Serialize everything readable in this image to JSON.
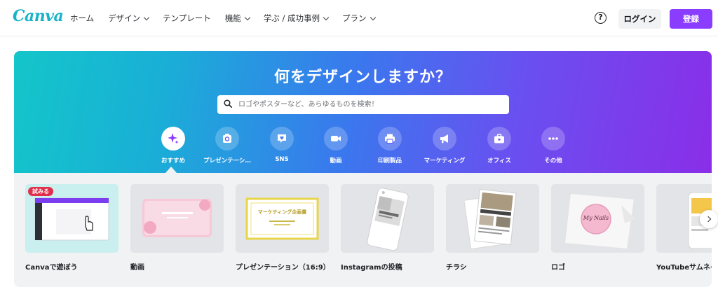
{
  "header": {
    "logo": "Canva",
    "nav": [
      {
        "label": "ホーム",
        "dropdown": false
      },
      {
        "label": "デザイン",
        "dropdown": true
      },
      {
        "label": "テンプレート",
        "dropdown": false
      },
      {
        "label": "機能",
        "dropdown": true
      },
      {
        "label": "学ぶ / 成功事例",
        "dropdown": true
      },
      {
        "label": "プラン",
        "dropdown": true
      }
    ],
    "help_icon": "?",
    "login_label": "ログイン",
    "signup_label": "登録"
  },
  "hero": {
    "title": "何をデザインしますか？",
    "search_placeholder": "ロゴやポスターなど、あらゆるものを検索！",
    "categories": [
      {
        "label": "おすすめ",
        "icon": "sparkle-icon",
        "active": true
      },
      {
        "label": "プレゼンテーシ…",
        "icon": "presentation-icon",
        "active": false
      },
      {
        "label": "SNS",
        "icon": "heart-chat-icon",
        "active": false
      },
      {
        "label": "動画",
        "icon": "video-camera-icon",
        "active": false
      },
      {
        "label": "印刷製品",
        "icon": "printer-icon",
        "active": false
      },
      {
        "label": "マーケティング",
        "icon": "megaphone-icon",
        "active": false
      },
      {
        "label": "オフィス",
        "icon": "briefcase-icon",
        "active": false
      },
      {
        "label": "その他",
        "icon": "more-dots-icon",
        "active": false
      }
    ]
  },
  "cards": [
    {
      "label": "Canvaで遊ぼう",
      "badge": "試みる"
    },
    {
      "label": "動画"
    },
    {
      "label": "プレゼンテーション（16:9）",
      "thumb_title": "マーケティング企画書"
    },
    {
      "label": "Instagramの投稿"
    },
    {
      "label": "チラシ"
    },
    {
      "label": "ロゴ",
      "thumb_text": "My Nails"
    },
    {
      "label": "YouTubeサムネイル"
    }
  ],
  "colors": {
    "brand_purple": "#8b3dff",
    "logo_teal": "#18b3c7",
    "badge_red": "#e12e4b"
  }
}
